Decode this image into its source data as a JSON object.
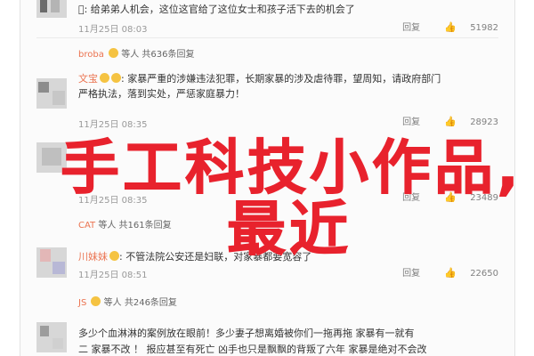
{
  "overlay": {
    "line1": "手工科技小作品,",
    "line2": "最近"
  },
  "comments": [
    {
      "text_line1": ": 给弟弟人机会，这位这官给了这位女士和孩子活下去的机会了",
      "time": "11月25日 08:03",
      "reply_label": "回复",
      "likes": "51982"
    },
    {
      "sub_user": "broba",
      "sub_text": "等人 共636条回复"
    },
    {
      "user": "文宝",
      "text_line1": "家暴严重的涉嫌违法犯罪，长期家暴的涉及虐待罪，望周知，请政府部门",
      "text_line2": "严格执法，落到实处，严惩家庭暴力！",
      "time": "11月25日 08:35",
      "reply_label": "回复",
      "likes": "28923"
    },
    {
      "time": "11月25日 08:35",
      "reply_label": "回复",
      "likes": "23489"
    },
    {
      "sub_user": "CAT",
      "sub_text": "等人 共161条回复"
    },
    {
      "user": "川妹妹",
      "text_line1": "不管法院公安还是妇联，对家暴都要宽容了",
      "time": "11月25日 08:51",
      "reply_label": "回复",
      "likes": "22650"
    },
    {
      "sub_user": "JS",
      "sub_text": "等人 共246条回复"
    },
    {
      "text_line1": "多少个血淋淋的案例放在眼前！多少妻子想离婚被你们一拖再拖 家暴有一就有",
      "text_line2": "二 家暴不改 ！ 报应甚至有死亡 凶手也只是飘飘的背叛了六年 家暴是绝对不会改"
    }
  ]
}
